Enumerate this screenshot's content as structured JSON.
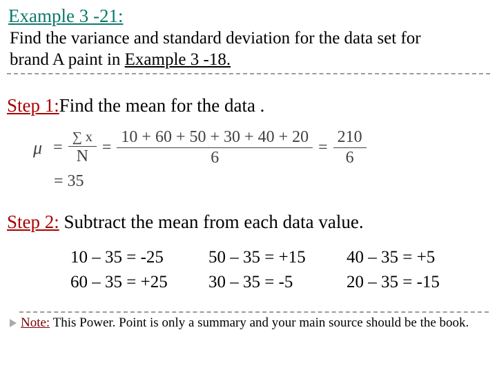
{
  "title": "Example 3 -21:",
  "prompt_line1": "Find the variance and standard deviation for the data set for",
  "prompt_line2_pre": "brand A paint in ",
  "prompt_line2_ul": "Example 3 -18.",
  "step1": {
    "label": "Step 1:",
    "text": "Find the mean for the data ."
  },
  "formula": {
    "mu": "μ",
    "eq": "=",
    "frac1_num": "∑ x",
    "frac1_den": "N",
    "frac2_num": "10 + 60 + 50 + 30 + 40 + 20",
    "frac2_den": "6",
    "frac3_num": "210",
    "frac3_den": "6",
    "result": "= 35"
  },
  "step2": {
    "label": "Step 2:",
    "text": " Subtract the mean from each data value."
  },
  "deviations": [
    [
      "10 – 35 = -25",
      "50 – 35 = +15",
      "40 – 35 = +5"
    ],
    [
      "60 – 35 = +25",
      "30 – 35 = -5",
      "20 – 35 = -15"
    ]
  ],
  "footer": {
    "label": "Note:",
    "text": " This Power. Point is only a summary and your main source should be the book."
  },
  "chart_data": {
    "type": "table",
    "title": "Brand A paint data — deviations from mean",
    "values": [
      10,
      60,
      50,
      30,
      40,
      20
    ],
    "N": 6,
    "sum": 210,
    "mean": 35,
    "deviations": [
      -25,
      25,
      15,
      -5,
      5,
      -15
    ]
  }
}
